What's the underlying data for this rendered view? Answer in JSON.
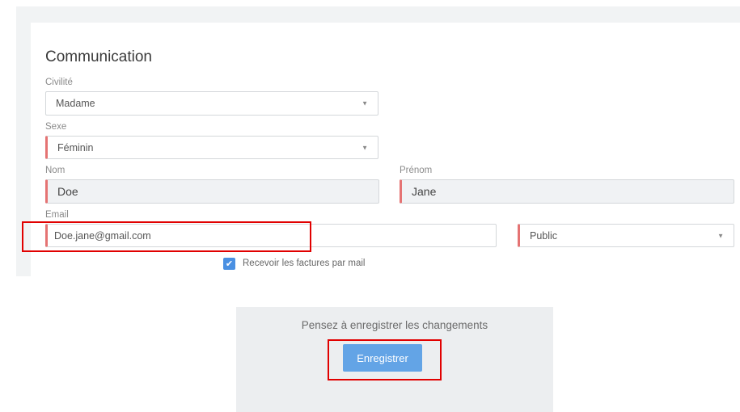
{
  "form": {
    "title": "Communication",
    "civilite": {
      "label": "Civilité",
      "value": "Madame"
    },
    "sexe": {
      "label": "Sexe",
      "value": "Féminin"
    },
    "nom": {
      "label": "Nom",
      "value": "Doe"
    },
    "prenom": {
      "label": "Prénom",
      "value": "Jane"
    },
    "email": {
      "label": "Email",
      "value": "Doe.jane@gmail.com"
    },
    "visibility": {
      "value": "Public"
    },
    "invoices_by_mail": {
      "label": "Recevoir les factures par mail",
      "checked": true
    }
  },
  "save_panel": {
    "message": "Pensez à enregistrer les changements",
    "button_label": "Enregistrer"
  },
  "colors": {
    "accent": "#63a4e6",
    "required": "#e57373",
    "highlight": "#e10000"
  },
  "icons": {
    "caret": "caret-down-icon",
    "check": "checkmark-icon"
  }
}
